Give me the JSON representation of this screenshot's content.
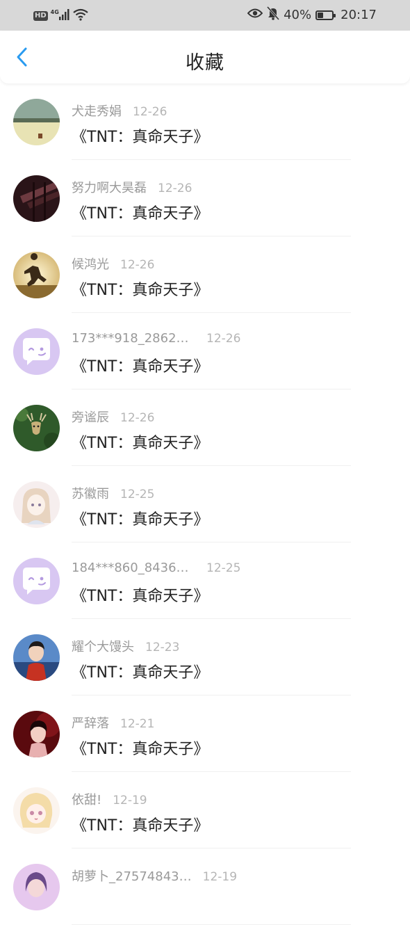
{
  "status_bar": {
    "hd": "HD",
    "network": "4G",
    "battery_percent": "40%",
    "battery_level": 0.4,
    "time": "20:17",
    "icons": [
      "signal-icon",
      "wifi-icon",
      "eye-icon",
      "mute-bell-icon",
      "battery-icon"
    ]
  },
  "header": {
    "back_icon": "chevron-left-icon",
    "title": "收藏",
    "accent_color": "#2a9bf0"
  },
  "items": [
    {
      "user": "犬走秀娟",
      "date": "12-26",
      "title": "《TNT：真命天子》",
      "avatar": "landscape-photo"
    },
    {
      "user": "努力啊大昊磊",
      "date": "12-26",
      "title": "《TNT：真命天子》",
      "avatar": "dark-photo"
    },
    {
      "user": "候鸿光",
      "date": "12-26",
      "title": "《TNT：真命天子》",
      "avatar": "runner-photo"
    },
    {
      "user": "173***918_28621…",
      "date": "12-26",
      "title": "《TNT：真命天子》",
      "avatar": "default-chat-avatar"
    },
    {
      "user": "旁谧辰",
      "date": "12-26",
      "title": "《TNT：真命天子》",
      "avatar": "deer-photo"
    },
    {
      "user": "苏徽雨",
      "date": "12-25",
      "title": "《TNT：真命天子》",
      "avatar": "anime-girl"
    },
    {
      "user": "184***860_84361…",
      "date": "12-25",
      "title": "《TNT：真命天子》",
      "avatar": "default-chat-avatar"
    },
    {
      "user": "耀个大馒头",
      "date": "12-23",
      "title": "《TNT：真命天子》",
      "avatar": "person-photo"
    },
    {
      "user": "严辞落",
      "date": "12-21",
      "title": "《TNT：真命天子》",
      "avatar": "red-portrait"
    },
    {
      "user": "依甜!",
      "date": "12-19",
      "title": "《TNT：真命天子》",
      "avatar": "anime-blonde"
    },
    {
      "user": "胡萝卜_27574843…",
      "date": "12-19",
      "title": "",
      "avatar": "purple-photo"
    }
  ]
}
